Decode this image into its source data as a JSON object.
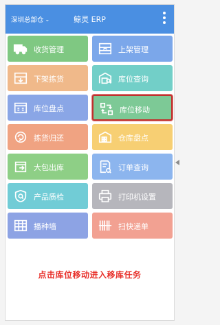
{
  "header": {
    "location": "深圳总部仓",
    "title": "鲸灵 ERP",
    "bg_color": "#4a8fe2"
  },
  "tiles": [
    {
      "label": "收货管理",
      "icon": "truck-icon",
      "color": "#7fc882",
      "highlighted": false
    },
    {
      "label": "上架管理",
      "icon": "shelf-up-icon",
      "color": "#7ba7ea",
      "highlighted": false
    },
    {
      "label": "下架拣货",
      "icon": "shelf-down-icon",
      "color": "#f0b98a",
      "highlighted": false
    },
    {
      "label": "库位查询",
      "icon": "warehouse-search-icon",
      "color": "#72cfc8",
      "highlighted": false
    },
    {
      "label": "库位盘点",
      "icon": "location-count-icon",
      "color": "#8aa6e6",
      "highlighted": false
    },
    {
      "label": "库位移动",
      "icon": "location-move-icon",
      "color": "#7dc996",
      "highlighted": true
    },
    {
      "label": "拣货归还",
      "icon": "return-icon",
      "color": "#f0a382",
      "highlighted": false
    },
    {
      "label": "仓库盘点",
      "icon": "warehouse-count-icon",
      "color": "#f7cf73",
      "highlighted": false
    },
    {
      "label": "大包出库",
      "icon": "package-out-icon",
      "color": "#8ecf86",
      "highlighted": false
    },
    {
      "label": "订单查询",
      "icon": "order-query-icon",
      "color": "#8cb5ee",
      "highlighted": false
    },
    {
      "label": "产品质检",
      "icon": "quality-check-icon",
      "color": "#71ccd6",
      "highlighted": false
    },
    {
      "label": "打印机设置",
      "icon": "printer-icon",
      "color": "#b6b6bc",
      "highlighted": false
    },
    {
      "label": "播种墙",
      "icon": "seed-wall-icon",
      "color": "#8da3e4",
      "highlighted": false
    },
    {
      "label": "扫快递单",
      "icon": "scan-express-icon",
      "color": "#f2a192",
      "highlighted": false
    }
  ],
  "caption": "点击库位移动进入移库任务"
}
